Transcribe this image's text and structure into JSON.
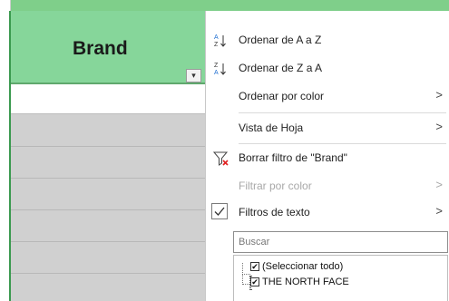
{
  "sheet": {
    "header_label": "Brand",
    "filter_button_symbol": "▾"
  },
  "menu": {
    "sort_az": "Ordenar de A a Z",
    "sort_za": "Ordenar de Z a A",
    "sort_by_color": "Ordenar por color",
    "sheet_view": "Vista de Hoja",
    "clear_filter": "Borrar filtro de \"Brand\"",
    "filter_by_color": "Filtrar por color",
    "text_filters": "Filtros de texto",
    "search_placeholder": "Buscar",
    "list": [
      {
        "label": "(Seleccionar todo)",
        "checked": true
      },
      {
        "label": "THE NORTH FACE",
        "checked": true
      }
    ]
  },
  "colors": {
    "header_green": "#86d69a",
    "border_green": "#3b9a4f",
    "marker_red": "#e02020",
    "disabled_text": "#a8a8a8"
  }
}
